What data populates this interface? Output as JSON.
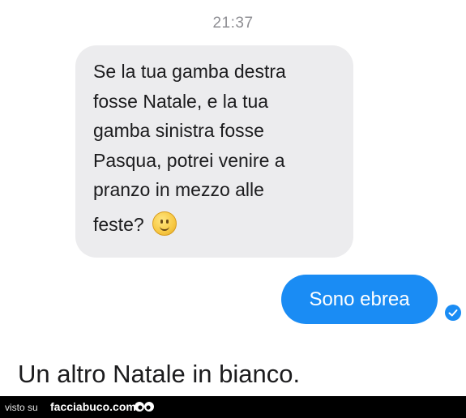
{
  "chat": {
    "timestamp": "21:37",
    "incoming_message": {
      "lines": [
        "Se la tua gamba destra",
        "fosse Natale, e la tua",
        "gamba sinistra fosse",
        "Pasqua, potrei venire a",
        "pranzo in mezzo alle",
        "feste?"
      ],
      "emoji": "slightly-smiling-face-icon"
    },
    "outgoing_message": {
      "text": "Sono ebrea",
      "status_icon": "checkmark-circle-icon"
    }
  },
  "caption": "Un altro Natale in bianco.",
  "footer": {
    "prefix": "visto su",
    "site": "facciabuco.com",
    "logo_icon": "googly-eyes-icon"
  },
  "colors": {
    "incoming_bubble": "#ececee",
    "outgoing_bubble": "#1a8cf4",
    "footer_background": "#000000"
  }
}
